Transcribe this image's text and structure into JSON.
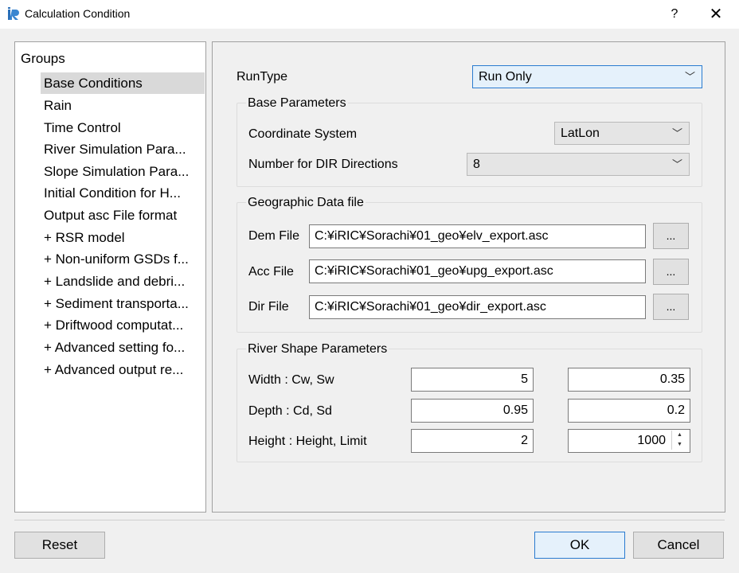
{
  "window": {
    "title": "Calculation Condition",
    "help": "?",
    "close": "✕"
  },
  "tree": {
    "header": "Groups",
    "items": [
      "Base Conditions",
      "Rain",
      "Time Control",
      "River Simulation Para...",
      "Slope Simulation Para...",
      "Initial Condition for H...",
      "Output asc File format",
      "+ RSR model",
      "+ Non-uniform GSDs f...",
      "+ Landslide and debri...",
      "+ Sediment transporta...",
      "+ Driftwood computat...",
      "+ Advanced setting fo...",
      "+ Advanced output re..."
    ]
  },
  "runtype": {
    "label": "RunType",
    "value": "Run Only"
  },
  "base_params": {
    "title": "Base Parameters",
    "coord_label": "Coordinate System",
    "coord_value": "LatLon",
    "dir_label": "Number for DIR Directions",
    "dir_value": "8"
  },
  "geo": {
    "title": "Geographic Data file",
    "dem_label": "Dem File",
    "dem_value": "C:¥iRIC¥Sorachi¥01_geo¥elv_export.asc",
    "acc_label": "Acc File",
    "acc_value": "C:¥iRIC¥Sorachi¥01_geo¥upg_export.asc",
    "dir_label": "Dir File",
    "dir_value": "C:¥iRIC¥Sorachi¥01_geo¥dir_export.asc",
    "browse": "..."
  },
  "river_shape": {
    "title": "River Shape Parameters",
    "width_label": "Width : Cw, Sw",
    "width_cw": "5",
    "width_sw": "0.35",
    "depth_label": "Depth : Cd, Sd",
    "depth_cd": "0.95",
    "depth_sd": "0.2",
    "height_label": "Height : Height, Limit",
    "height_value": "2",
    "height_limit": "1000"
  },
  "buttons": {
    "reset": "Reset",
    "ok": "OK",
    "cancel": "Cancel"
  }
}
